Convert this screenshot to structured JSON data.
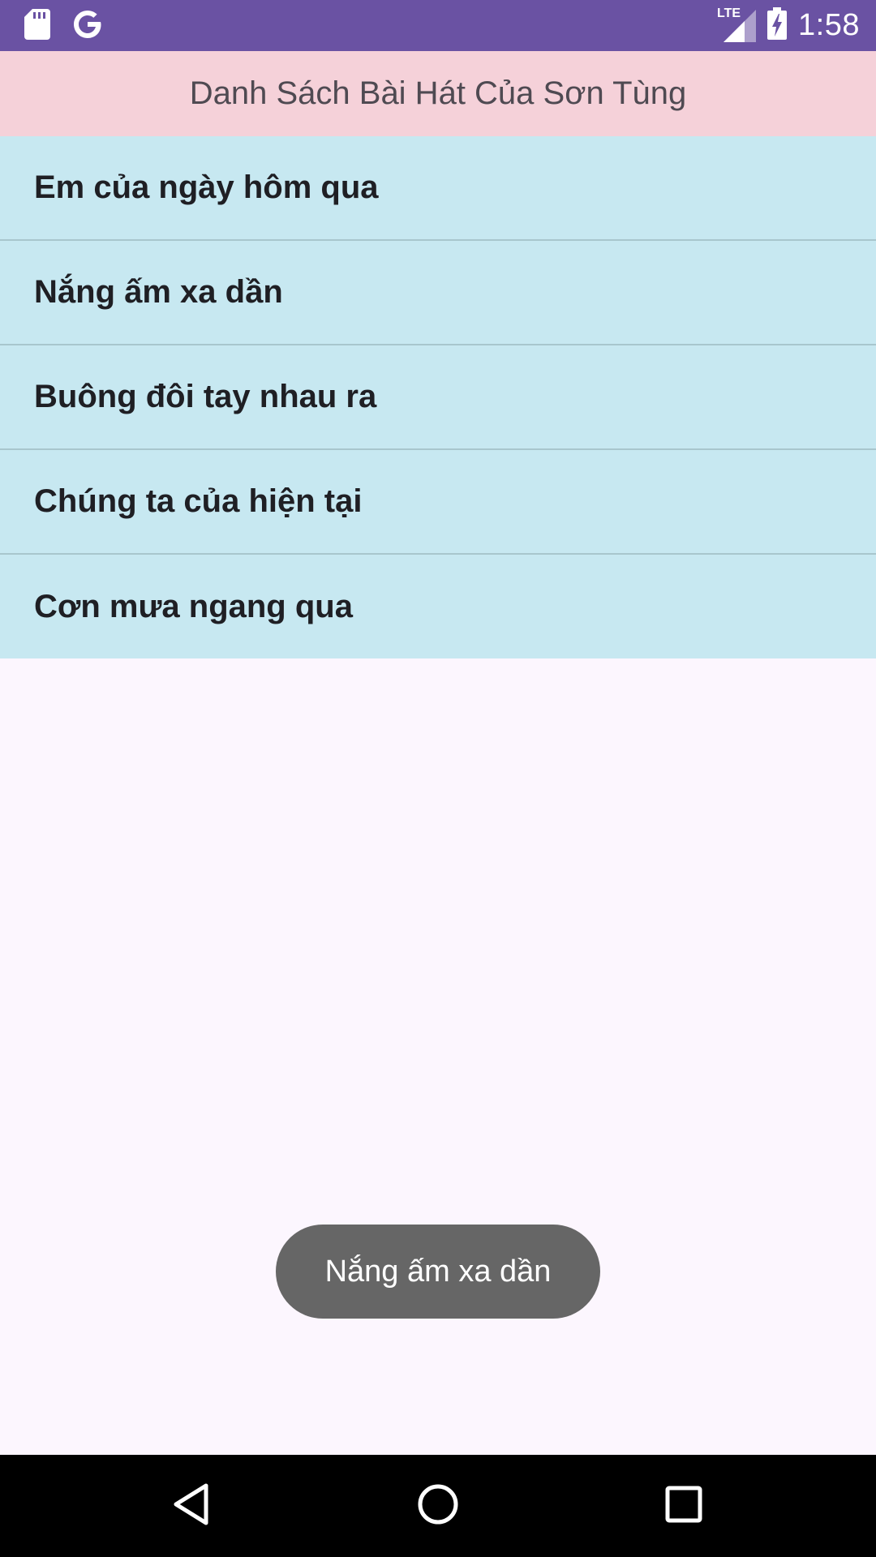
{
  "status_bar": {
    "time": "1:58",
    "network": "LTE",
    "icons": [
      "sd-card-icon",
      "google-icon",
      "signal-icon",
      "battery-charging-icon"
    ]
  },
  "app_bar": {
    "title": "Danh Sách Bài Hát Của Sơn Tùng"
  },
  "songs": [
    {
      "label": "Em của ngày hôm qua"
    },
    {
      "label": "Nắng ấm xa dần"
    },
    {
      "label": "Buông đôi tay nhau ra"
    },
    {
      "label": "Chúng ta của hiện tại"
    },
    {
      "label": "Cơn mưa ngang qua"
    }
  ],
  "toast": {
    "text": "Nắng ấm xa dần"
  },
  "nav_bar": {
    "icons": [
      "back-icon",
      "home-icon",
      "recents-icon"
    ]
  },
  "colors": {
    "status_bar": "#6a52a3",
    "app_bar": "#f5d1d9",
    "list_item": "#c7e8f1",
    "background": "#fcf6fe",
    "toast": "#666666"
  }
}
